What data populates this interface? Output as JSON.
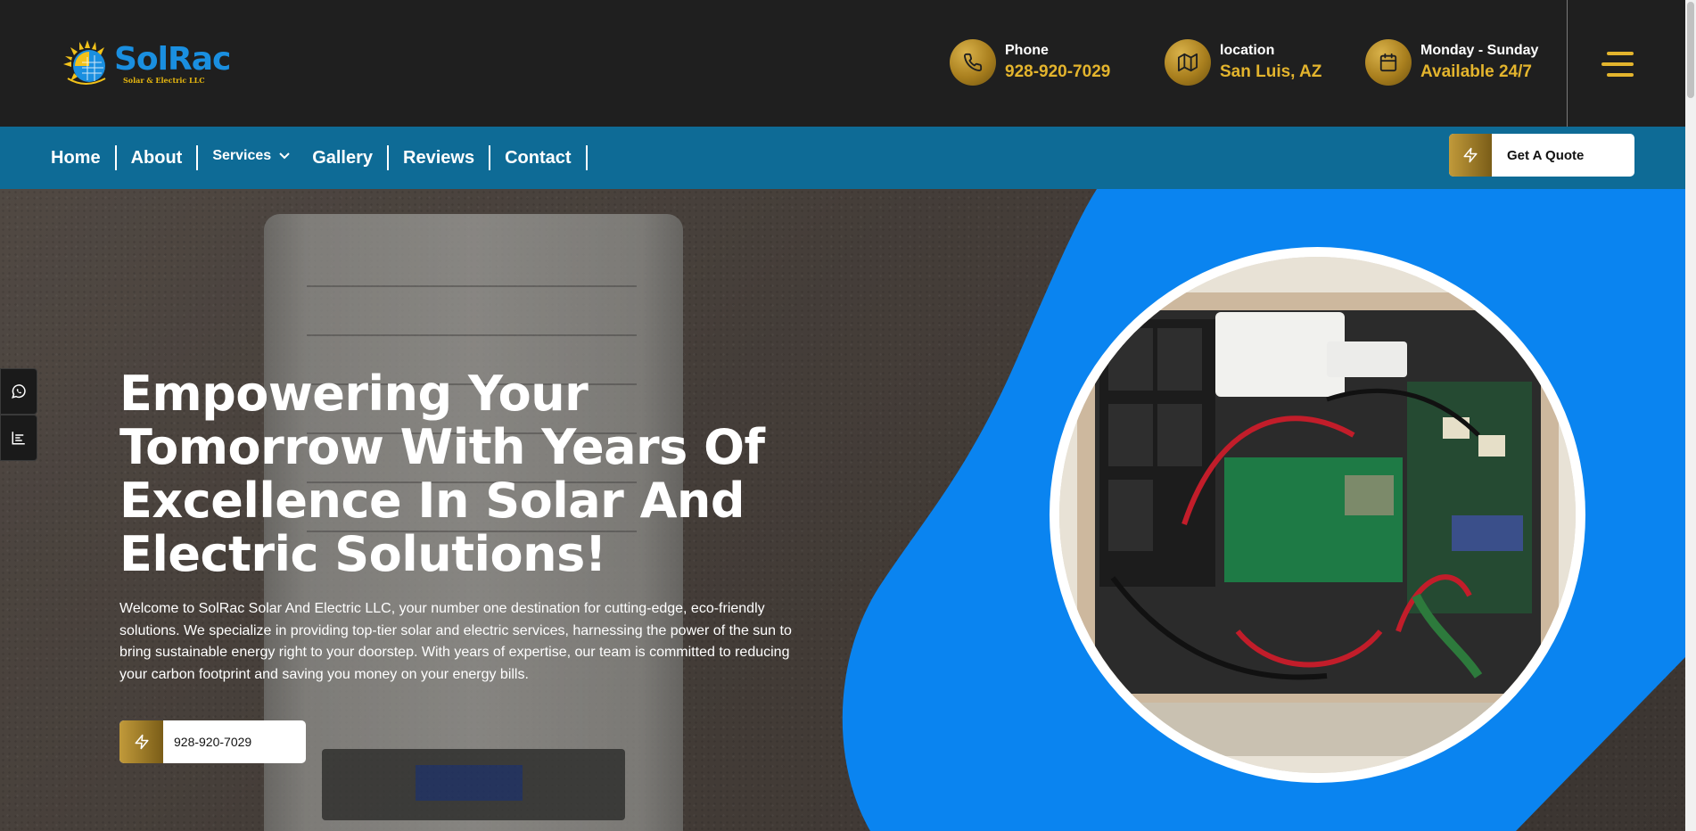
{
  "brand": {
    "name": "SolRac",
    "tagline": "Solar & Electric LLC",
    "colors": {
      "blue": "#1a8fe0",
      "gold": "#e3b42d",
      "nav": "#0e6b96",
      "hero_blue": "#0a84f0"
    }
  },
  "header": {
    "contacts": [
      {
        "icon": "phone-icon",
        "label": "Phone",
        "value": "928-920-7029"
      },
      {
        "icon": "map-icon",
        "label": "location",
        "value": "San Luis, AZ"
      },
      {
        "icon": "calendar-icon",
        "label": "Monday - Sunday",
        "value": "Available 24/7"
      }
    ],
    "menu_icon": "hamburger-icon"
  },
  "nav": {
    "items": [
      "Home",
      "About",
      "Services",
      "Gallery",
      "Reviews",
      "Contact"
    ],
    "quote_button": "Get A Quote"
  },
  "hero": {
    "title": "Empowering Your Tomorrow With Years Of Excellence In Solar And Electric Solutions!",
    "description": "Welcome to SolRac Solar And Electric LLC, your number one destination for cutting-edge, eco-friendly solutions. We specialize in providing top-tier solar and electric services, harnessing the power of the sun to bring sustainable energy right to your doorstep. With years of expertise, our team is committed to reducing your carbon footprint and saving you money on your energy bills.",
    "call_button": "928-920-7029"
  },
  "floating": [
    "whatsapp-icon",
    "chart-icon"
  ]
}
